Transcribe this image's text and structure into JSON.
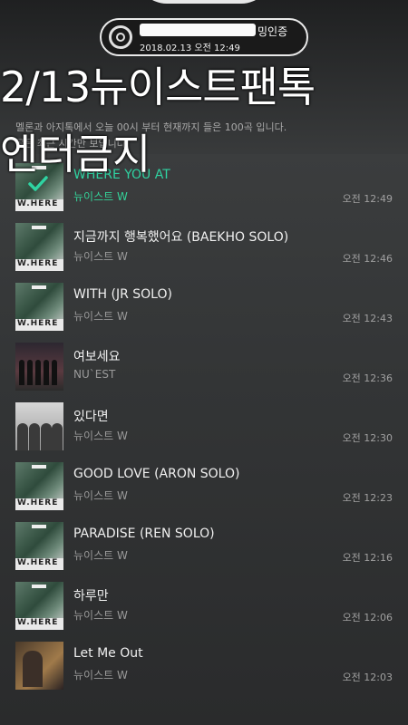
{
  "header": {
    "pill_label": "밍인증",
    "pill_date": "2018.02.13 오전 12:49"
  },
  "overlay": {
    "line1": "2/13뉴이스트팬톡",
    "line2": "엔터금지"
  },
  "notice": {
    "line1": "멜론과 아지톡에서 오늘 00시 부터 현재까지 들은 100곡 입니다.",
    "line2": "곡은 최근 시간만 보입니다."
  },
  "tracks": [
    {
      "title": "WHERE YOU AT",
      "artist": "뉴이스트 W",
      "time": "오전 12:49",
      "active": true
    },
    {
      "title": "지금까지 행복했어요 (BAEKHO SOLO)",
      "artist": "뉴이스트 W",
      "time": "오전 12:46"
    },
    {
      "title": "WITH (JR SOLO)",
      "artist": "뉴이스트 W",
      "time": "오전 12:43"
    },
    {
      "title": "여보세요",
      "artist": "NU`EST",
      "time": "오전 12:36"
    },
    {
      "title": "있다면",
      "artist": "뉴이스트 W",
      "time": "오전 12:30"
    },
    {
      "title": "GOOD LOVE (ARON SOLO)",
      "artist": "뉴이스트 W",
      "time": "오전 12:23"
    },
    {
      "title": "PARADISE (REN SOLO)",
      "artist": "뉴이스트 W",
      "time": "오전 12:16"
    },
    {
      "title": "하루만",
      "artist": "뉴이스트 W",
      "time": "오전 12:06"
    },
    {
      "title": "Let Me Out",
      "artist": "뉴이스트 W",
      "time": "오전 12:03"
    }
  ],
  "album_art_text": "W.HERE",
  "colors": {
    "active": "#2fd3a2",
    "background": "#2a2c2d"
  }
}
